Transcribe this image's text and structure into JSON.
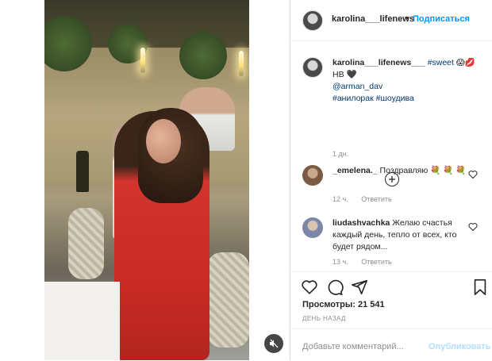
{
  "post": {
    "author": "karolina___lifenews",
    "follow_label": "Подписаться",
    "dot": "•",
    "caption": {
      "author": "karolina___lifenews___",
      "hashtag_sweet": "#sweet",
      "emoji_line": "😱💋",
      "line2": "НВ 🖤",
      "mention": "@arman_dav",
      "tags": "#анилорак #шоудива",
      "time": "1 дн."
    }
  },
  "comments": [
    {
      "user": "_emelena._",
      "text": "Поздравляю 💐 💐 💐",
      "time": "12 ч.",
      "reply_label": "Ответить",
      "avatar_color": "#8a6a4a"
    },
    {
      "user": "liudashvachka",
      "text": "Желаю счастья каждый день, тепло от всех, кто будет рядом...",
      "time": "13 ч.",
      "reply_label": "Ответить",
      "avatar_color": "#9aa0b8"
    }
  ],
  "stats": {
    "views": "Просмотры: 21 541",
    "date": "день назад"
  },
  "composer": {
    "placeholder": "Добавьте комментарий...",
    "publish_label": "Опубликовать"
  },
  "icons": {
    "like": "heart-icon",
    "comment": "comment-icon",
    "share": "share-icon",
    "save": "bookmark-icon",
    "mute": "mute-icon",
    "load_more": "plus-circle-icon"
  }
}
